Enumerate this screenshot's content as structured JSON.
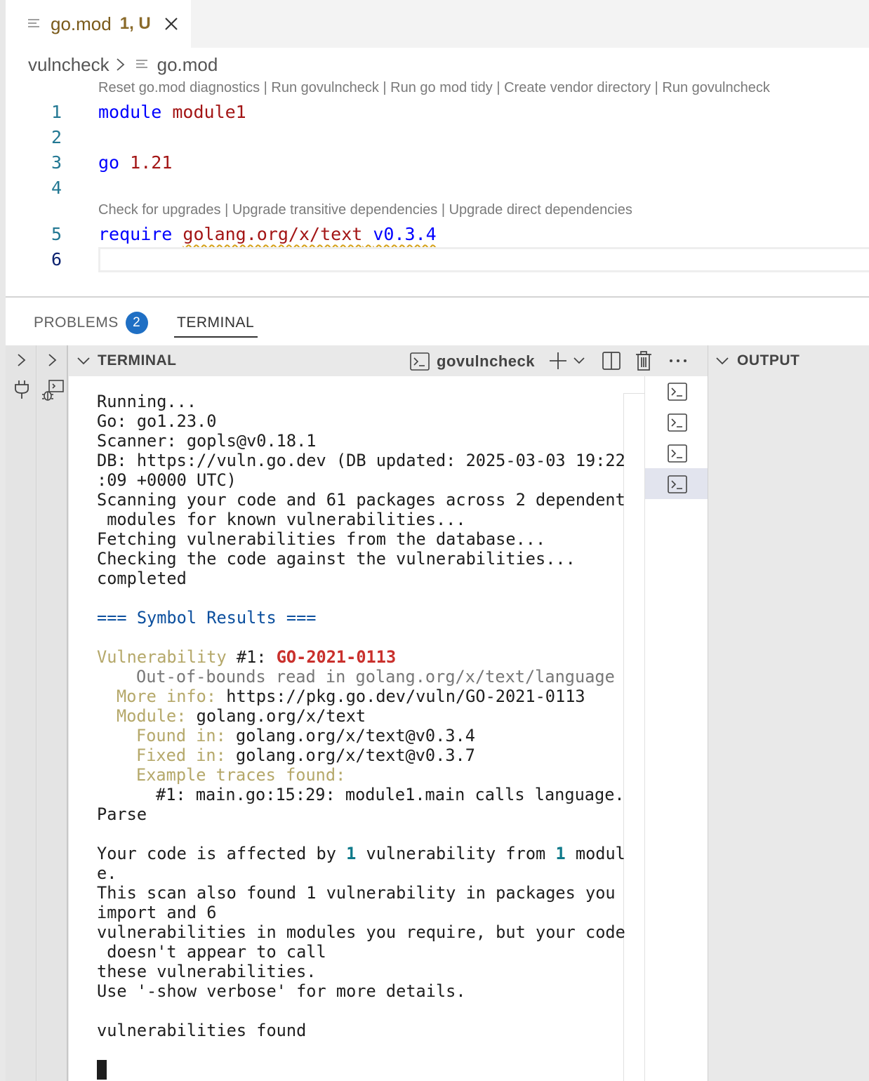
{
  "editor": {
    "tab": {
      "name": "go.mod",
      "status": "1, U"
    },
    "breadcrumb": {
      "folder": "vulncheck",
      "file": "go.mod"
    },
    "codelens_top": "Reset go.mod diagnostics | Run govulncheck | Run go mod tidy | Create vendor directory | Run govulncheck",
    "codelens_require": "Check for upgrades | Upgrade transitive dependencies | Upgrade direct dependencies",
    "lines": [
      {
        "num": "1",
        "kw": "module",
        "val": "module1"
      },
      {
        "num": "2"
      },
      {
        "num": "3",
        "kw": "go",
        "val": "1.21"
      },
      {
        "num": "4"
      },
      {
        "num": "5",
        "kw": "require",
        "pkg": "golang.org/x/text",
        "ver": "v0.3.4"
      },
      {
        "num": "6"
      }
    ]
  },
  "panel": {
    "tabs": {
      "problems": "PROBLEMS",
      "problems_count": "2",
      "terminal": "TERMINAL"
    },
    "terminal_header": "TERMINAL",
    "terminal_name": "govulncheck",
    "output_header": "OUTPUT"
  },
  "terminal": {
    "l1": "Running...",
    "l2": "Go: go1.23.0",
    "l3": "Scanner: gopls@v0.18.1",
    "l4": "DB: https://vuln.go.dev (DB updated: 2025-03-03 19:22",
    "l5": ":09 +0000 UTC)",
    "l6": "Scanning your code and 61 packages across 2 dependent",
    "l7": " modules for known vulnerabilities...",
    "l8": "Fetching vulnerabilities from the database...",
    "l9": "Checking the code against the vulnerabilities...",
    "l10": "completed",
    "symbol_results": "=== Symbol Results ===",
    "vuln_label": "Vulnerability",
    "vuln_num": " #1: ",
    "vuln_id": "GO-2021-0113",
    "vuln_desc": "Out-of-bounds read in golang.org/x/text/language",
    "more_info_label": "More info:",
    "more_info": " https://pkg.go.dev/vuln/GO-2021-0113",
    "module_label": "Module:",
    "module": " golang.org/x/text",
    "found_label": "Found in:",
    "found": " golang.org/x/text@v0.3.4",
    "fixed_label": "Fixed in:",
    "fixed": " golang.org/x/text@v0.3.7",
    "traces_label": "Example traces found:",
    "trace1": "#1: main.go:15:29: module1.main calls language.",
    "trace1b": "Parse",
    "affected_a": "Your code is affected by ",
    "affected_n1": "1",
    "affected_b": " vulnerability from ",
    "affected_n2": "1",
    "affected_c": " modul",
    "affected_d": "e.",
    "s1": "This scan also found 1 vulnerability in packages you",
    "s2": "import and 6",
    "s3": "vulnerabilities in modules you require, but your code",
    "s4": " doesn't appear to call",
    "s5": "these vulnerabilities.",
    "s6": "Use '-show verbose' for more details.",
    "final": "vulnerabilities found"
  }
}
